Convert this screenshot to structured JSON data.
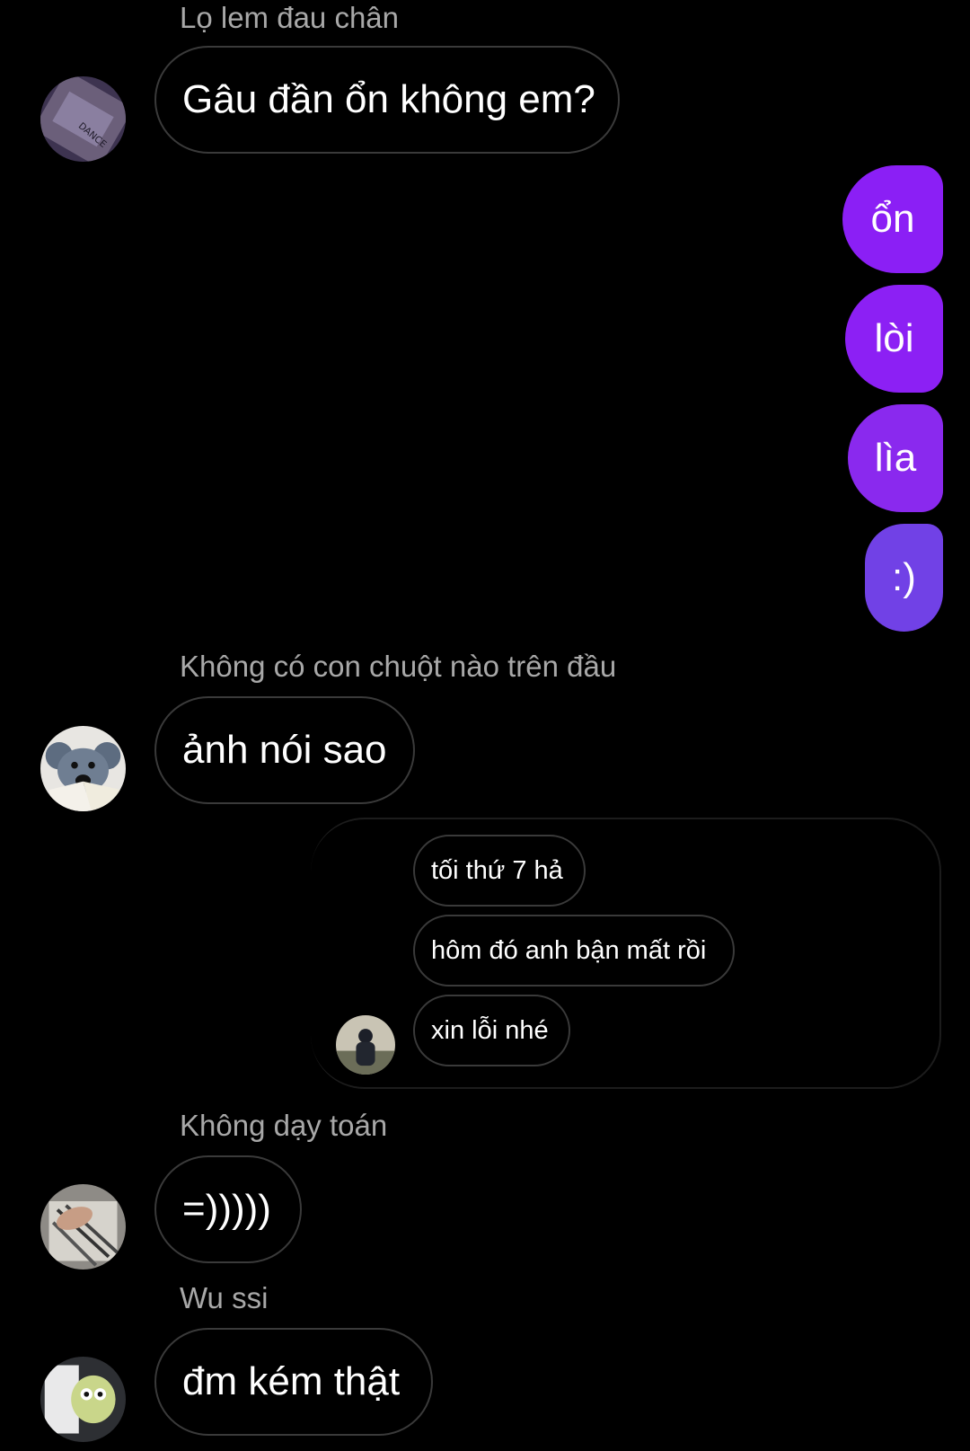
{
  "messages": {
    "m1": {
      "sender": "Lọ lem đau chân",
      "text": "Gâu đần ổn không em?"
    },
    "outgoing": [
      {
        "text": "ổn"
      },
      {
        "text": "lòi"
      },
      {
        "text": "lìa"
      },
      {
        "text": ":)"
      }
    ],
    "m2": {
      "sender": "Không có con chuột nào trên đầu",
      "text": "ảnh nói sao"
    },
    "quoted": {
      "lines": [
        {
          "text": "tối thứ 7 hả"
        },
        {
          "text": "hôm đó anh bận mất rồi"
        },
        {
          "text": "xin lỗi nhé"
        }
      ]
    },
    "m3": {
      "sender": "Không dạy toán",
      "text": "=)))))"
    },
    "m4": {
      "sender": "Wu ssi",
      "text": "đm kém thật"
    }
  },
  "colors": {
    "background": "#000000",
    "outgoing_bubble_top": "#8b1ff5",
    "outgoing_bubble_bottom": "#6a4ce8",
    "incoming_border": "#3a3a3a",
    "sender_name": "#a8a8a8"
  },
  "icons": {
    "avatar_1": "dance-poster-avatar",
    "avatar_2": "rat-reading-book-avatar",
    "avatar_3": "person-standing-avatar",
    "avatar_4": "vinyl-records-avatar",
    "avatar_5": "plush-toy-avatar"
  }
}
